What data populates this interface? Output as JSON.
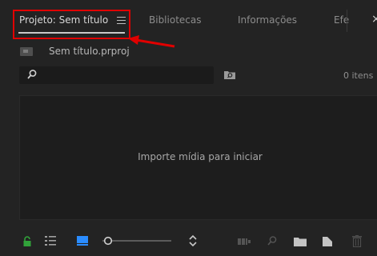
{
  "tabs": [
    {
      "label": "Projeto: Sem título",
      "active": true
    },
    {
      "label": "Bibliotecas",
      "active": false
    },
    {
      "label": "Informações",
      "active": false
    },
    {
      "label": "Efe",
      "active": false
    }
  ],
  "close_label": "×",
  "project": {
    "file_name": "Sem título.prproj"
  },
  "search": {
    "value": "",
    "placeholder": ""
  },
  "item_count": "0 itens",
  "drop_zone": {
    "message": "Importe mídia para iniciar"
  },
  "toolbar": {
    "zoom_fraction": 0.1
  },
  "annotation": {
    "highlight_color": "#e00000"
  },
  "colors": {
    "accent": "#2a8cff",
    "lock": "#31a33a",
    "bg": "#232323"
  }
}
